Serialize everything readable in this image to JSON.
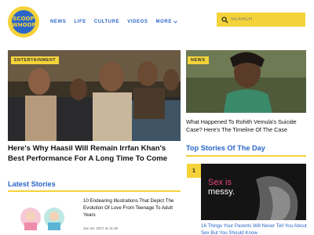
{
  "brand": {
    "logo_line1": "SCOOP",
    "logo_line2": "WHOOP"
  },
  "nav": {
    "items": [
      "NEWS",
      "LIFE",
      "CULTURE",
      "VIDEOS",
      "MORE"
    ],
    "more_chevron": "chevron-down-icon"
  },
  "search": {
    "placeholder": "SEARCH"
  },
  "hero": {
    "badge": "ENTERTAINMENT",
    "title": "Here's Why Haasil Will Remain Irrfan Khan's Best Performance For A Long Time To Come"
  },
  "side_story": {
    "badge": "NEWS",
    "title": "What Happened To Rohith Vemula's Suicide Case? Here's The Timeline Of The Case"
  },
  "latest": {
    "heading": "Latest Stories",
    "item": {
      "title": "10 Endearing Illustrations That Depict The Evolution Of Love From Teenage To Adult Years",
      "date": "Jan 18, 2017 at 11:36"
    }
  },
  "top_stories": {
    "heading": "Top Stories Of The Day",
    "item": {
      "rank": "1",
      "image_text_line1": "Sex is",
      "image_text_line2": "messy.",
      "title": "16 Things Your Parents Will Never Tell You About Sex But You Should Know"
    }
  },
  "colors": {
    "accent_yellow": "#f4d33a",
    "brand_blue": "#2a66c8"
  }
}
